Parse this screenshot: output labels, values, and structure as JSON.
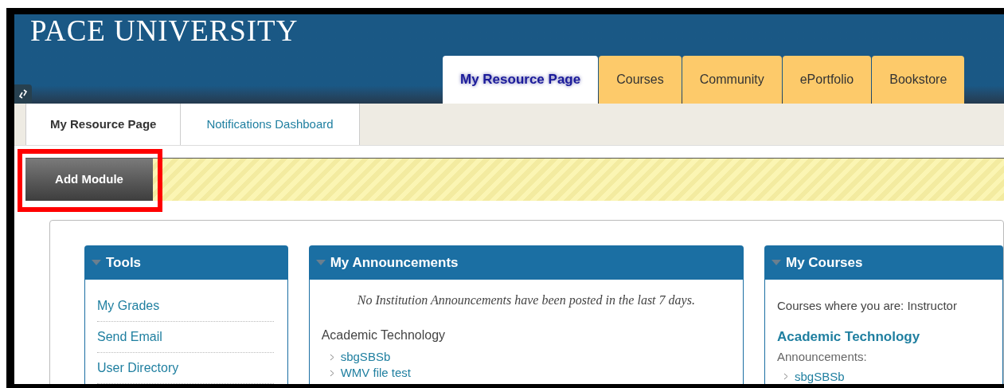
{
  "header": {
    "title": "PACE UNIVERSITY"
  },
  "top_tabs": [
    {
      "label": "My Resource Page",
      "selected": true
    },
    {
      "label": "Courses",
      "selected": false
    },
    {
      "label": "Community",
      "selected": false
    },
    {
      "label": "ePortfolio",
      "selected": false
    },
    {
      "label": "Bookstore",
      "selected": false
    }
  ],
  "sub_tabs": [
    {
      "label": "My Resource Page",
      "selected": true
    },
    {
      "label": "Notifications Dashboard",
      "selected": false
    }
  ],
  "add_module": {
    "label": "Add Module",
    "highlighted": true
  },
  "modules": [
    {
      "title": "Tools",
      "kind": "links",
      "links": [
        "My Grades",
        "Send Email",
        "User Directory"
      ]
    },
    {
      "title": "My Announcements",
      "kind": "announcements",
      "notice": "No Institution Announcements have been posted in the last 7 days.",
      "group": "Academic Technology",
      "items": [
        "sbgSBSb",
        "WMV file test"
      ]
    },
    {
      "title": "My Courses",
      "kind": "courses",
      "role": "Courses where you are: Instructor",
      "course": "Academic Technology",
      "sublabel": "Announcements:",
      "items": [
        "sbgSBSb"
      ]
    }
  ]
}
